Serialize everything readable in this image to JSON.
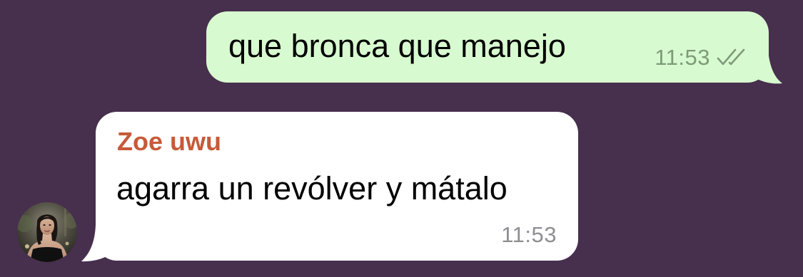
{
  "chat": {
    "background_color": "#472F4E",
    "outgoing": {
      "text": "que bronca que manejo",
      "time": "11:53",
      "status_icon": "double-check-icon",
      "bubble_color": "#D8FAD0",
      "meta_color": "#7E9B79"
    },
    "incoming": {
      "sender": "Zoe uwu",
      "sender_color": "#C75A38",
      "text": "agarra un revólver y mátalo",
      "time": "11:53",
      "bubble_color": "#FFFFFF",
      "avatar_icon": "contact-avatar"
    }
  }
}
